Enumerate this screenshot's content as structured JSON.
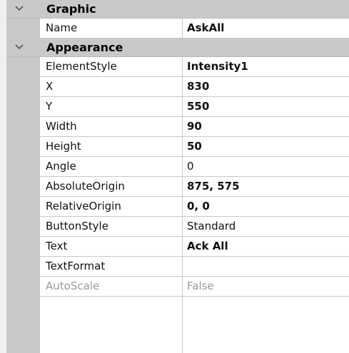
{
  "categories": [
    {
      "label": "Graphic",
      "expanded": true,
      "properties": [
        {
          "name": "Name",
          "value": "AskAll",
          "bold": true,
          "disabled": false
        }
      ]
    },
    {
      "label": "Appearance",
      "expanded": true,
      "properties": [
        {
          "name": "ElementStyle",
          "value": "Intensity1",
          "bold": true,
          "disabled": false
        },
        {
          "name": "X",
          "value": "830",
          "bold": true,
          "disabled": false
        },
        {
          "name": "Y",
          "value": "550",
          "bold": true,
          "disabled": false
        },
        {
          "name": "Width",
          "value": "90",
          "bold": true,
          "disabled": false
        },
        {
          "name": "Height",
          "value": "50",
          "bold": true,
          "disabled": false
        },
        {
          "name": "Angle",
          "value": "0",
          "bold": false,
          "disabled": false
        },
        {
          "name": "AbsoluteOrigin",
          "value": "875, 575",
          "bold": true,
          "disabled": false
        },
        {
          "name": "RelativeOrigin",
          "value": "0, 0",
          "bold": true,
          "disabled": false
        },
        {
          "name": "ButtonStyle",
          "value": "Standard",
          "bold": false,
          "disabled": false
        },
        {
          "name": "Text",
          "value": "Ack All",
          "bold": true,
          "disabled": false
        },
        {
          "name": "TextFormat",
          "value": "",
          "bold": false,
          "disabled": false
        },
        {
          "name": "AutoScale",
          "value": "False",
          "bold": false,
          "disabled": true
        }
      ]
    }
  ],
  "colors": {
    "category_bg": "#c9c9c9",
    "grid_line": "#c8c8c8",
    "disabled_text": "#9a9a9a"
  }
}
